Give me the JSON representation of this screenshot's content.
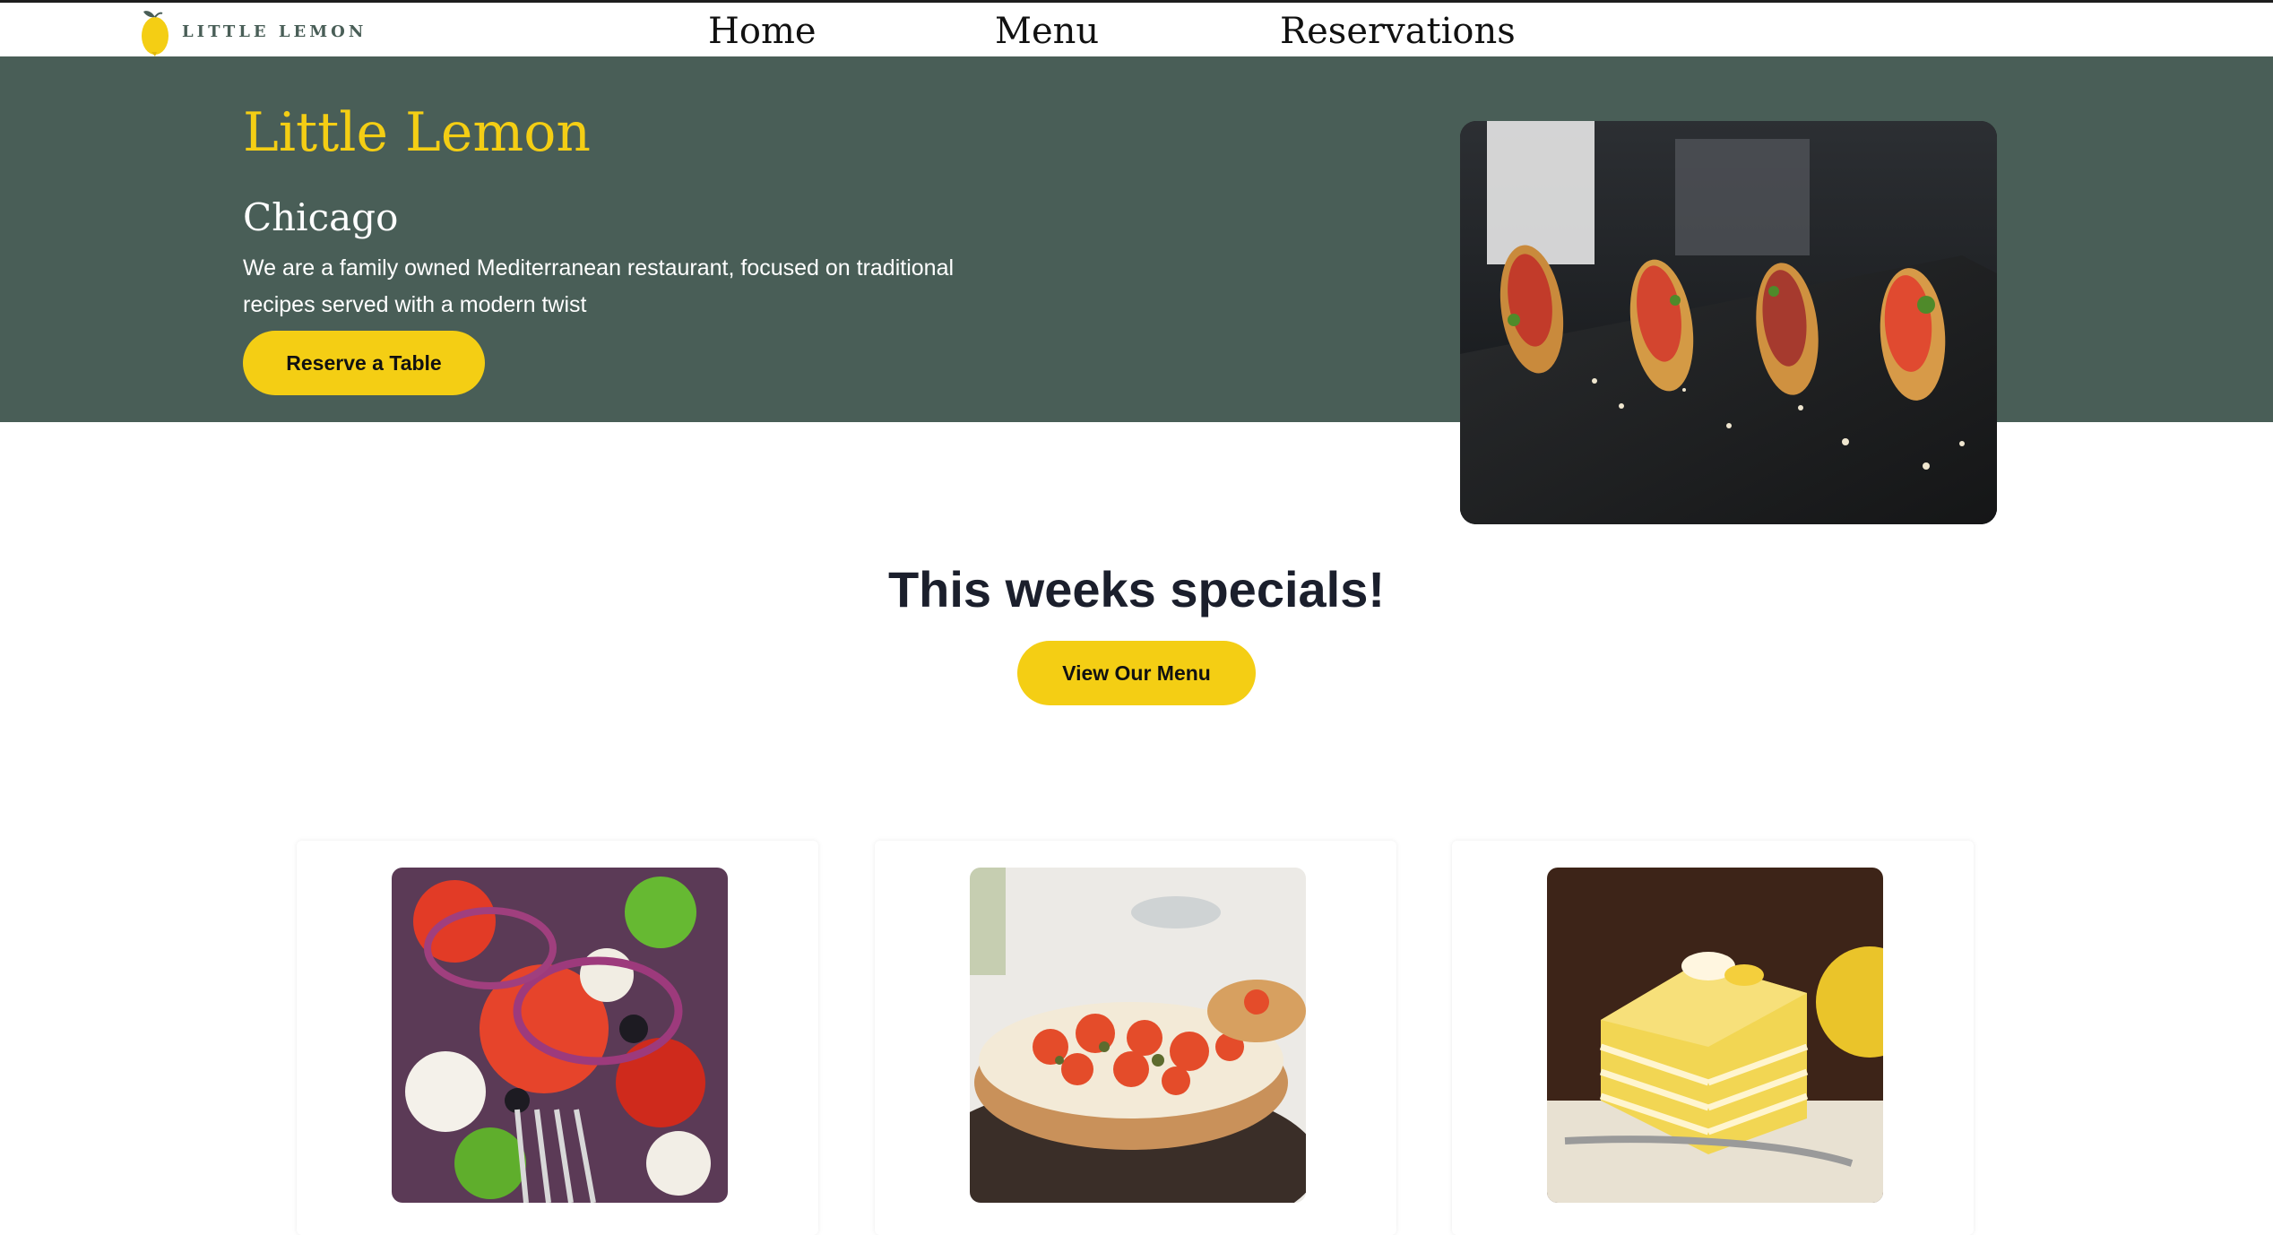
{
  "header": {
    "logo_text": "LITTLE LEMON",
    "nav": [
      "Home",
      "Menu",
      "Reservations"
    ]
  },
  "hero": {
    "title": "Little Lemon",
    "subtitle": "Chicago",
    "description": "We are a family owned Mediterranean restaurant, focused on traditional recipes served with a modern twist",
    "button_label": "Reserve a Table"
  },
  "specials": {
    "title": "This weeks specials!",
    "button_label": "View Our Menu"
  },
  "colors": {
    "brand_green": "#495e57",
    "brand_yellow": "#f4ce14",
    "heading_dark": "#1b1f2c"
  }
}
